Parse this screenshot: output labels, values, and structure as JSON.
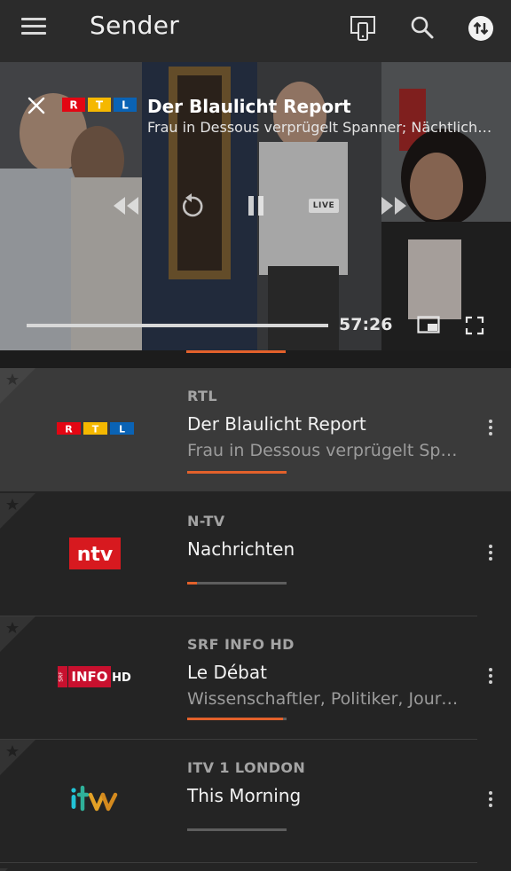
{
  "appbar": {
    "title": "Sender",
    "icons": [
      "menu-icon",
      "cast-device-icon",
      "search-icon",
      "sync-icon"
    ]
  },
  "player": {
    "channel_logo": "RTL",
    "title": "Der Blaulicht Report",
    "subtitle": "Frau in Dessous verprügelt Spanner; Nächtliche Ruhestörung",
    "live_badge": "LIVE",
    "time": "57:26",
    "progress": 1.0,
    "controls": [
      "rewind-icon",
      "replay-icon",
      "pause-icon",
      "forward-icon"
    ]
  },
  "channels": [
    {
      "channel": "RTL",
      "show": "Der Blaulicht Report",
      "episode": "Frau in Dessous verprügelt Spanner",
      "progress": 1.0,
      "active": true,
      "logo": "RTL"
    },
    {
      "channel": "N-TV",
      "show": "Nachrichten",
      "episode": "",
      "progress": 0.1,
      "active": false,
      "logo": "ntv"
    },
    {
      "channel": "SRF INFO HD",
      "show": "Le Débat",
      "episode": "Wissenschaftler, Politiker, Journalisten",
      "progress": 0.96,
      "active": false,
      "logo_text": "INFO",
      "logo_prefix": "SRF",
      "logo_suffix": "HD"
    },
    {
      "channel": "ITV 1 LONDON",
      "show": "This Morning",
      "episode": "",
      "progress": 0.0,
      "active": false,
      "logo": "itv"
    }
  ],
  "colors": {
    "accent": "#e3612b",
    "rtl_red": "#e30613",
    "ntv_red": "#d7191f",
    "srf_red": "#c8102e"
  }
}
